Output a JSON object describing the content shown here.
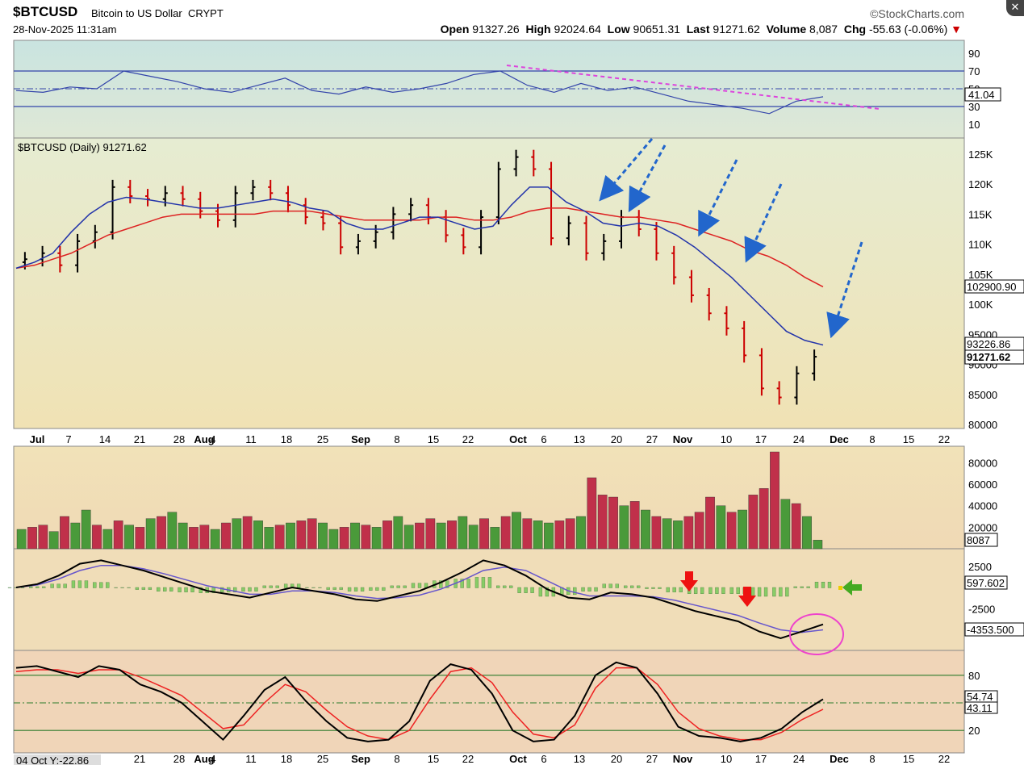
{
  "header": {
    "symbol": "$BTCUSD",
    "description": "Bitcoin to US Dollar",
    "exchange": "CRYPT",
    "watermark": "©StockCharts.com",
    "datetime": "28-Nov-2025 11:31am",
    "open_label": "Open",
    "open": "91327.26",
    "high_label": "High",
    "high": "92024.64",
    "low_label": "Low",
    "low": "90651.31",
    "last_label": "Last",
    "last": "91271.62",
    "volume_label": "Volume",
    "volume": "8,087",
    "chg_label": "Chg",
    "chg": "-55.63 (-0.06%)",
    "close_icon": "close-icon"
  },
  "colors": {
    "up": "#000000",
    "down": "#cc0000",
    "ma_fast": "#2233aa",
    "ma_slow": "#dd2222",
    "vol_up": "#4a9a3a",
    "vol_down": "#c0304a",
    "rsi_line": "#3344aa",
    "trend_magenta": "#dd44dd",
    "arrow_blue": "#2266cc"
  },
  "chart_data": [
    {
      "type": "line",
      "name": "RSI",
      "ylim": [
        0,
        100
      ],
      "ticks": [
        90,
        70,
        50,
        30,
        10
      ],
      "last": "41.04",
      "x": [
        0,
        5,
        10,
        15,
        20,
        25,
        30,
        35,
        40,
        45,
        50,
        55,
        60,
        65,
        70,
        75,
        80,
        85,
        90,
        95,
        100,
        105,
        110,
        115,
        120,
        125,
        130,
        135,
        140,
        145,
        150
      ],
      "values": [
        48,
        46,
        52,
        50,
        70,
        64,
        58,
        50,
        46,
        54,
        62,
        48,
        44,
        52,
        46,
        50,
        56,
        66,
        70,
        54,
        46,
        56,
        48,
        52,
        44,
        36,
        32,
        28,
        22,
        36,
        41
      ],
      "annotation": "magenta dashed downtrend line"
    },
    {
      "type": "candlestick",
      "name": "$BTCUSD (Daily) 91271.62",
      "ylim": [
        80000,
        127000
      ],
      "yticks": [
        "125K",
        "120K",
        "115K",
        "110K",
        "105K",
        "100K",
        "95000",
        "90000",
        "85000",
        "80000"
      ],
      "x_labels": [
        "Jul",
        "7",
        "14",
        "21",
        "28",
        "Aug",
        "4",
        "11",
        "18",
        "25",
        "Sep",
        "8",
        "15",
        "22",
        "Oct",
        "6",
        "13",
        "20",
        "27",
        "Nov",
        "10",
        "17",
        "24",
        "Dec",
        "8",
        "15",
        "22"
      ],
      "close": [
        107500,
        108500,
        106500,
        110500,
        112000,
        119500,
        118000,
        117500,
        118500,
        117500,
        115500,
        114000,
        118500,
        119500,
        118500,
        116500,
        114500,
        113500,
        109500,
        110500,
        112000,
        115000,
        116500,
        114500,
        111500,
        109500,
        114500,
        122500,
        124500,
        122500,
        111000,
        113500,
        108500,
        110500,
        114500,
        112500,
        108500,
        104500,
        101500,
        98500,
        96000,
        91500,
        86000,
        84500,
        88500,
        91271
      ],
      "ma_fast_last": "93226.86",
      "ma_slow_last": "102900.90",
      "last_tag": "91271.62",
      "ma_fast": [
        106000,
        107000,
        108500,
        112000,
        115000,
        117000,
        117800,
        117500,
        117000,
        116500,
        116000,
        116000,
        116500,
        117000,
        117500,
        117000,
        116000,
        115500,
        113500,
        112500,
        112500,
        113500,
        114500,
        114500,
        113500,
        112500,
        113000,
        116500,
        119500,
        119500,
        117000,
        115500,
        113500,
        113000,
        113500,
        113000,
        111500,
        109500,
        107000,
        104500,
        101500,
        98500,
        95500,
        94000,
        93226
      ],
      "ma_slow": [
        106000,
        106500,
        107500,
        108500,
        110000,
        111500,
        112500,
        113500,
        114500,
        115000,
        115000,
        115000,
        115000,
        115000,
        115500,
        115500,
        115500,
        115000,
        114500,
        114000,
        114000,
        114000,
        114000,
        114500,
        114500,
        114000,
        114000,
        114500,
        115500,
        116000,
        116000,
        115500,
        115000,
        114500,
        114500,
        114000,
        113500,
        112500,
        111500,
        110500,
        109000,
        108000,
        106500,
        104500,
        102900
      ]
    },
    {
      "type": "bar",
      "name": "Volume",
      "yticks": [
        "80000",
        "60000",
        "40000",
        "20000"
      ],
      "last": "8087",
      "values": [
        18,
        20,
        22,
        16,
        30,
        24,
        36,
        22,
        18,
        26,
        22,
        20,
        28,
        30,
        34,
        24,
        20,
        22,
        18,
        24,
        28,
        30,
        26,
        20,
        22,
        24,
        26,
        28,
        24,
        18,
        20,
        24,
        22,
        20,
        26,
        30,
        22,
        24,
        28,
        24,
        26,
        30,
        22,
        28,
        20,
        30,
        34,
        28,
        26,
        24,
        26,
        28,
        30,
        66,
        50,
        48,
        40,
        44,
        36,
        30,
        28,
        26,
        30,
        34,
        48,
        40,
        34,
        36,
        50,
        56,
        90,
        46,
        42,
        30,
        8
      ],
      "up": [
        1,
        0,
        0,
        1,
        0,
        1,
        1,
        0,
        1,
        0,
        1,
        0,
        1,
        0,
        1,
        1,
        0,
        0,
        1,
        0,
        1,
        0,
        1,
        1,
        0,
        1,
        0,
        0,
        1,
        1,
        0,
        1,
        0,
        1,
        0,
        1,
        1,
        0,
        0,
        1,
        0,
        1,
        1,
        0,
        1,
        0,
        1,
        0,
        1,
        1,
        0,
        0,
        1,
        0,
        0,
        0,
        1,
        0,
        1,
        0,
        1,
        1,
        0,
        0,
        0,
        1,
        0,
        1,
        0,
        0,
        0,
        1,
        0,
        1,
        1
      ]
    },
    {
      "type": "line",
      "name": "MACD",
      "yticks": [
        "2500",
        "-2500"
      ],
      "last_hist": "597.602",
      "last_macd": "-4353.500",
      "macd": [
        0,
        400,
        1400,
        2800,
        3200,
        2600,
        2000,
        1200,
        400,
        -400,
        -800,
        -1200,
        -600,
        0,
        -400,
        -800,
        -1400,
        -1600,
        -1000,
        -400,
        600,
        1800,
        3200,
        2600,
        1400,
        -200,
        -1200,
        -1400,
        -600,
        -800,
        -1200,
        -2000,
        -2800,
        -3400,
        -4000,
        -5200,
        -6000,
        -5200,
        -4353
      ],
      "signal": [
        0,
        300,
        1000,
        2000,
        2600,
        2600,
        2200,
        1600,
        900,
        200,
        -300,
        -800,
        -800,
        -400,
        -400,
        -600,
        -1000,
        -1300,
        -1200,
        -900,
        -200,
        800,
        2000,
        2400,
        2000,
        800,
        -400,
        -1000,
        -1000,
        -1000,
        -1100,
        -1500,
        -2100,
        -2700,
        -3300,
        -4200,
        -5000,
        -5300,
        -5000
      ],
      "annotation": "pink circle around MACD crossover, red down arrows, green left arrow"
    },
    {
      "type": "line",
      "name": "Stochastic",
      "ylim": [
        0,
        100
      ],
      "yticks": [
        "80",
        "20"
      ],
      "k_last": "54.74",
      "d_last": "43.11",
      "k": [
        88,
        90,
        84,
        78,
        90,
        86,
        70,
        62,
        50,
        30,
        10,
        36,
        64,
        78,
        52,
        30,
        12,
        8,
        10,
        30,
        74,
        92,
        86,
        60,
        20,
        8,
        10,
        36,
        80,
        94,
        88,
        60,
        24,
        14,
        12,
        8,
        12,
        22,
        40,
        54
      ],
      "d": [
        84,
        86,
        86,
        82,
        86,
        86,
        78,
        68,
        58,
        40,
        22,
        26,
        50,
        70,
        62,
        42,
        24,
        14,
        10,
        20,
        54,
        84,
        88,
        72,
        40,
        16,
        12,
        26,
        66,
        88,
        88,
        70,
        40,
        22,
        14,
        10,
        10,
        18,
        32,
        43
      ],
      "footer_label": "04 Oct Y:-22.86"
    }
  ],
  "panels": {
    "rsi_ticks": [
      "90",
      "70",
      "50",
      "30",
      "10"
    ],
    "rsi_last": "41.04",
    "price_title": "$BTCUSD (Daily) 91271.62",
    "price_tag_slow": "102900.90",
    "price_tag_fast": "93226.86",
    "price_tag_last": "91271.62",
    "vol_tag": "8087",
    "macd_tag1": "597.602",
    "macd_tag2": "-4353.500",
    "stoch_tag1": "54.74",
    "stoch_tag2": "43.11",
    "footer_label": "04 Oct Y:-22.86"
  }
}
